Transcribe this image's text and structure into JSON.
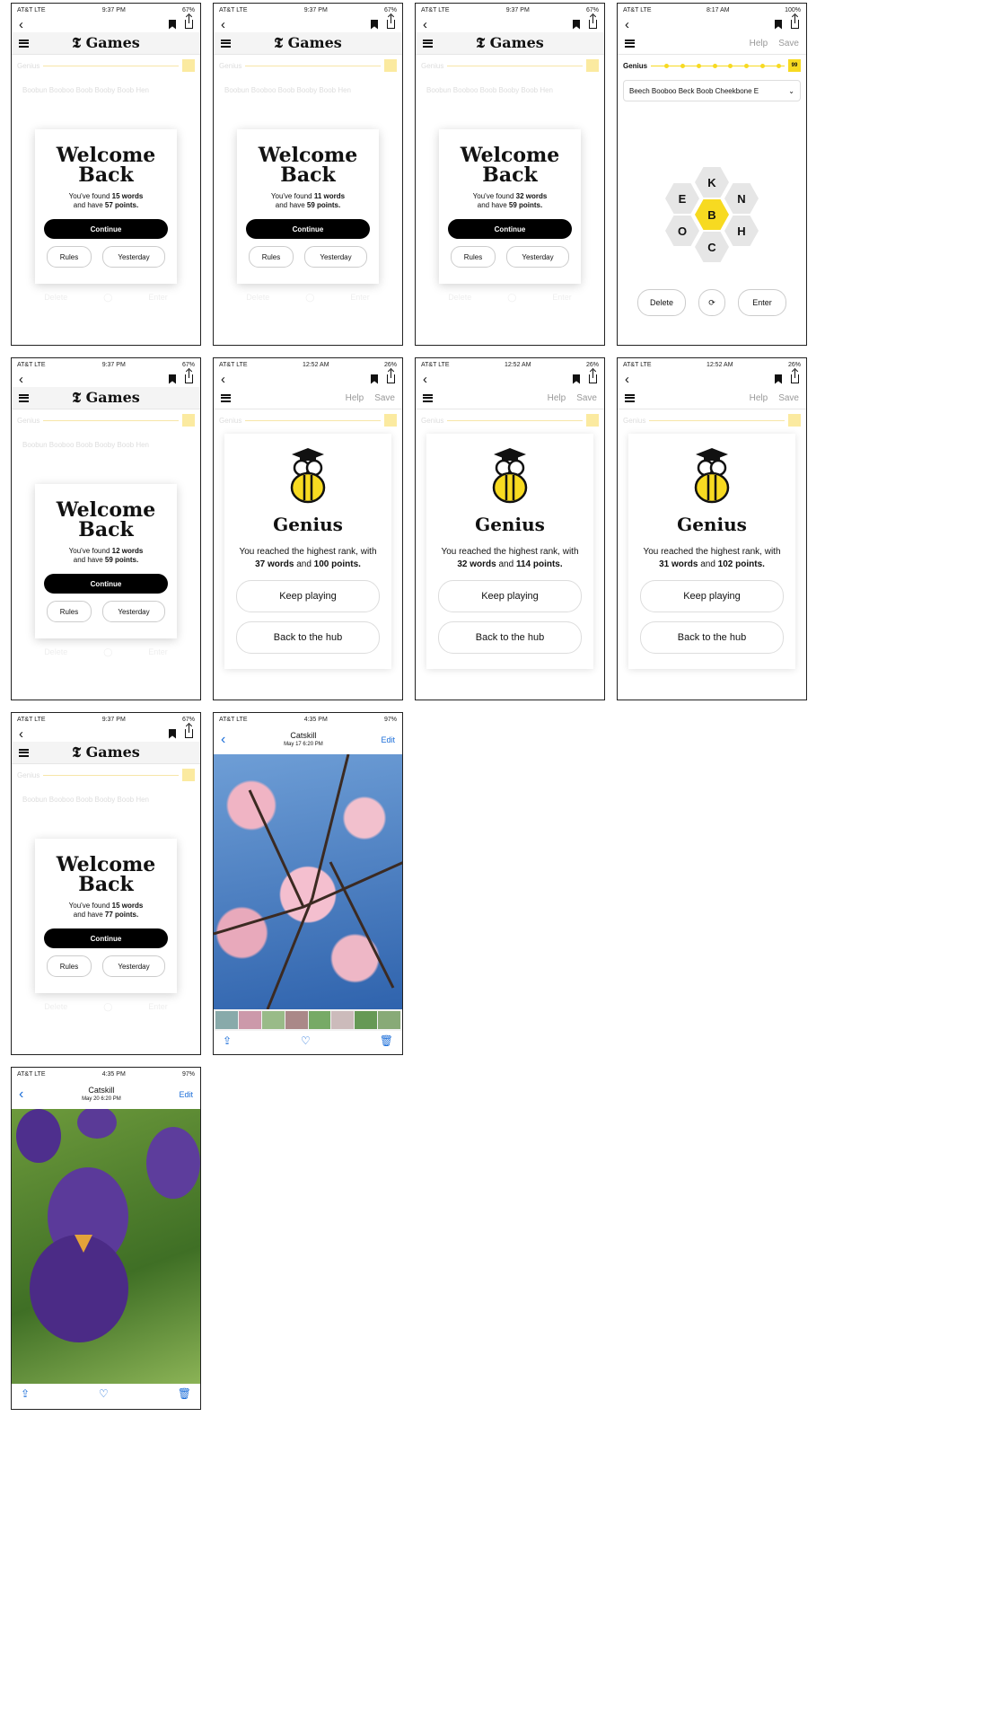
{
  "status_bars": {
    "carrier": "AT&T LTE",
    "time_937": "9:37 PM",
    "batt_67": "67%",
    "time_817": "8:17 AM",
    "batt_100": "100%",
    "time_1252": "12:52 AM",
    "batt_26": "26%",
    "time_435": "4:35 PM",
    "batt_97": "97%"
  },
  "games": {
    "logo_mark": "𝕿",
    "logo_text": "Games",
    "help": "Help",
    "save": "Save",
    "rank_label": "Genius",
    "faded_words": "Boobun Booboo Boob Booby Boob Hen",
    "delete": "Delete",
    "enter": "Enter"
  },
  "welcome_screens": [
    {
      "words": "15 words",
      "points": "57 points."
    },
    {
      "words": "11 words",
      "points": "59 points."
    },
    {
      "words": "32 words",
      "points": "59 points."
    },
    {
      "words": "12 words",
      "points": "59 points."
    },
    {
      "words": "15 words",
      "points": "77 points."
    }
  ],
  "welcome_text": {
    "title_line1": "Welcome",
    "title_line2": "Back",
    "found_prefix": "You've found ",
    "have_prefix": "and have ",
    "continue": "Continue",
    "rules": "Rules",
    "yesterday": "Yesterday"
  },
  "puzzle": {
    "rank_score": "99",
    "found_words": "Beech Booboo Beck Boob Cheekbone E",
    "letters": {
      "center": "B",
      "top": "K",
      "top_left": "E",
      "top_right": "N",
      "bottom_left": "O",
      "bottom_right": "H",
      "bottom": "C"
    }
  },
  "genius_screens": [
    {
      "words": "37 words",
      "points": "100 points."
    },
    {
      "words": "32 words",
      "points": "114 points."
    },
    {
      "words": "31 words",
      "points": "102 points."
    }
  ],
  "genius_text": {
    "title": "Genius",
    "reached": "You reached the highest rank, with",
    "and": " and ",
    "keep_playing": "Keep playing",
    "back_to_hub": "Back to the hub"
  },
  "photos": [
    {
      "album": "Catskill",
      "date": "May 17 6:20 PM",
      "edit": "Edit"
    },
    {
      "album": "Catskill",
      "date": "May 20 6:20 PM",
      "edit": "Edit"
    }
  ]
}
